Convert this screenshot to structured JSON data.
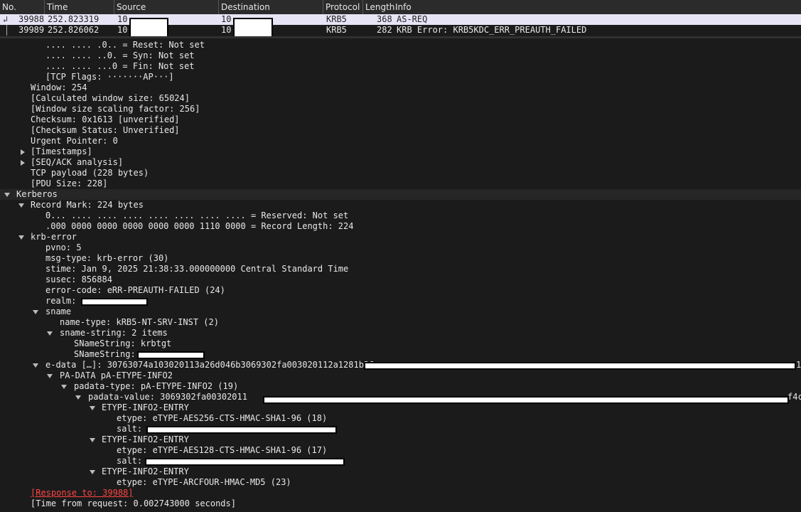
{
  "columns": {
    "no": "No.",
    "time": "Time",
    "source": "Source",
    "destination": "Destination",
    "protocol": "Protocol",
    "length": "Length",
    "info": "Info"
  },
  "packets": [
    {
      "no": "39988",
      "time": "252.823319",
      "source": "10",
      "destination": "10",
      "protocol": "KRB5",
      "length": "368",
      "info": "AS-REQ"
    },
    {
      "no": "39989",
      "time": "252.826062",
      "source": "10",
      "destination": "10",
      "protocol": "KRB5",
      "length": "282",
      "info": "KRB Error: KRB5KDC_ERR_PREAUTH_FAILED"
    }
  ],
  "tree": {
    "l0": ".... .... .0.. = Reset: Not set",
    "l1": ".... .... ..0. = Syn: Not set",
    "l2": ".... .... ...0 = Fin: Not set",
    "l3": "[TCP Flags: ·······AP···]",
    "l4": "Window: 254",
    "l5": "[Calculated window size: 65024]",
    "l6": "[Window size scaling factor: 256]",
    "l7": "Checksum: 0x1613 [unverified]",
    "l8": "[Checksum Status: Unverified]",
    "l9": "Urgent Pointer: 0",
    "l10": "[Timestamps]",
    "l11": "[SEQ/ACK analysis]",
    "l12": "TCP payload (228 bytes)",
    "l13": "[PDU Size: 228]",
    "l14": "Kerberos",
    "l15": "Record Mark: 224 bytes",
    "l16": "0... .... .... .... .... .... .... .... = Reserved: Not set",
    "l17": ".000 0000 0000 0000 0000 0000 1110 0000 = Record Length: 224",
    "l18": "krb-error",
    "l19": "pvno: 5",
    "l20": "msg-type: krb-error (30)",
    "l21": "stime: Jan  9, 2025 21:38:33.000000000 Central Standard Time",
    "l22": "susec: 856884",
    "l23": "error-code: eRR-PREAUTH-FAILED (24)",
    "l24": "realm:",
    "l25": "sname",
    "l26": "name-type: kRB5-NT-SRV-INST (2)",
    "l27": "sname-string: 2 items",
    "l28": "SNameString: krbtgt",
    "l29": "SNameString:",
    "l30": "e-data […]: 30763074a103020113a26d046b3069302fa003020112a1281b26",
    "l30b": "1",
    "l31": "PA-DATA pA-ETYPE-INFO2",
    "l32": "padata-type: pA-ETYPE-INFO2 (19)",
    "l33": "padata-value: 3069302fa00302011",
    "l33b": "f4c",
    "l34": "ETYPE-INFO2-ENTRY",
    "l35": "etype: eTYPE-AES256-CTS-HMAC-SHA1-96 (18)",
    "l36": "salt:",
    "l37": "ETYPE-INFO2-ENTRY",
    "l38": "etype: eTYPE-AES128-CTS-HMAC-SHA1-96 (17)",
    "l39": "salt:",
    "l40": "ETYPE-INFO2-ENTRY",
    "l41": "etype: eTYPE-ARCFOUR-HMAC-MD5 (23)",
    "l42": "[Response to: 39988]",
    "l43": "[Time from request: 0.002743000 seconds]"
  },
  "colors": {
    "background": "#1b1b1b",
    "selected_row": "#e7e4f6",
    "link": "#ff4444"
  }
}
